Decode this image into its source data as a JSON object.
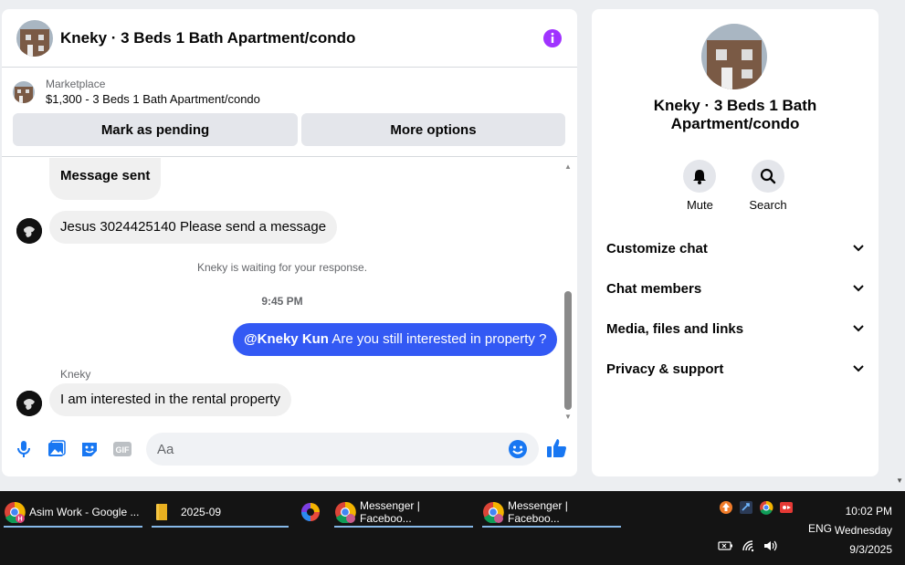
{
  "chat": {
    "title": "Kneky · 3 Beds 1 Bath Apartment/condo",
    "listing": {
      "source": "Marketplace",
      "price_title": "$1,300 - 3 Beds 1 Bath Apartment/condo",
      "mark_pending_label": "Mark as pending",
      "more_options_label": "More options"
    },
    "messages": {
      "sent_status": "Message sent",
      "incoming_1": "Jesus 3024425140 Please send a message",
      "waiting_note": "Kneky is waiting for your response.",
      "timestamp": "9:45 PM",
      "outgoing_mention": "@Kneky Kun",
      "outgoing_text": " Are you still interested in property ?",
      "sender_name": "Kneky",
      "incoming_2": "I am interested in the rental property"
    },
    "composer": {
      "placeholder": "Aa"
    }
  },
  "side": {
    "title": "Kneky · 3 Beds 1 Bath Apartment/condo",
    "mute_label": "Mute",
    "search_label": "Search",
    "menu": [
      {
        "label": "Customize chat"
      },
      {
        "label": "Chat members"
      },
      {
        "label": "Media, files and links"
      },
      {
        "label": "Privacy & support"
      }
    ]
  },
  "taskbar": {
    "tasks": [
      {
        "label": "Asim Work - Google ..."
      },
      {
        "label": "2025-09"
      },
      {
        "label": "Messenger | Faceboo..."
      },
      {
        "label": "Messenger | Faceboo..."
      }
    ],
    "language": "ENG",
    "time": "10:02 PM",
    "day": "Wednesday",
    "date": "9/3/2025"
  },
  "colors": {
    "accent": "#3359f4",
    "info": "#a033ff",
    "icon_blue": "#1877f2"
  }
}
